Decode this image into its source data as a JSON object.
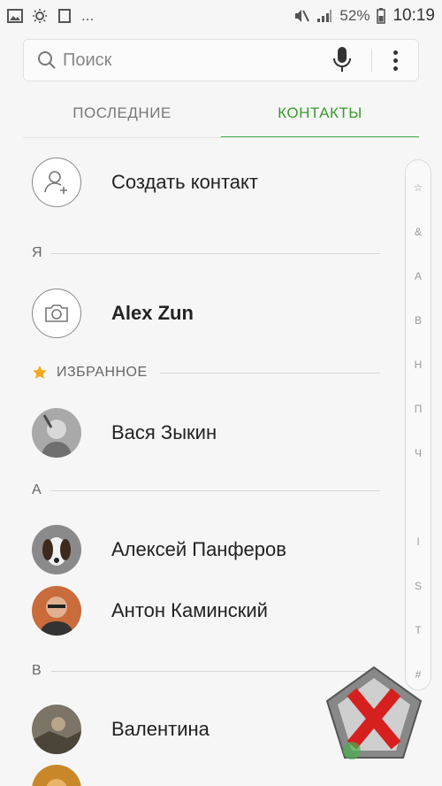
{
  "status_bar": {
    "left_icons": [
      "gallery-icon",
      "brightness-icon",
      "screen-icon"
    ],
    "overflow": "...",
    "right_icons": [
      "mute-vibrate-icon",
      "signal-icon",
      "battery-icon"
    ],
    "battery": "52%",
    "time": "10:19"
  },
  "search": {
    "placeholder": "Поиск",
    "icons": [
      "search-icon",
      "mic-icon",
      "more-vert-icon"
    ]
  },
  "tabs": [
    {
      "label": "ПОСЛЕДНИЕ",
      "active": false
    },
    {
      "label": "КОНТАКТЫ",
      "active": true
    }
  ],
  "create_contact": {
    "label": "Создать контакт",
    "icon": "add-person-icon"
  },
  "sections": {
    "ya": "Я",
    "favorites": "ИЗБРАННОЕ",
    "a": "А",
    "v": "В"
  },
  "profile": {
    "name": "Alex Zun",
    "icon": "camera-icon"
  },
  "contacts": [
    {
      "name": "Вася Зыкин",
      "section": "favorites"
    },
    {
      "name": "Алексей Панферов",
      "section": "А"
    },
    {
      "name": "Антон Каминский",
      "section": "А"
    },
    {
      "name": "Валентина",
      "section": "В"
    }
  ],
  "index_letters": [
    "☆",
    "&",
    "A",
    "B",
    "H",
    "П",
    "Ч",
    "I",
    "S",
    "T",
    "#"
  ],
  "accent_color": "#4caf50",
  "favorite_star_color": "#f5a623"
}
